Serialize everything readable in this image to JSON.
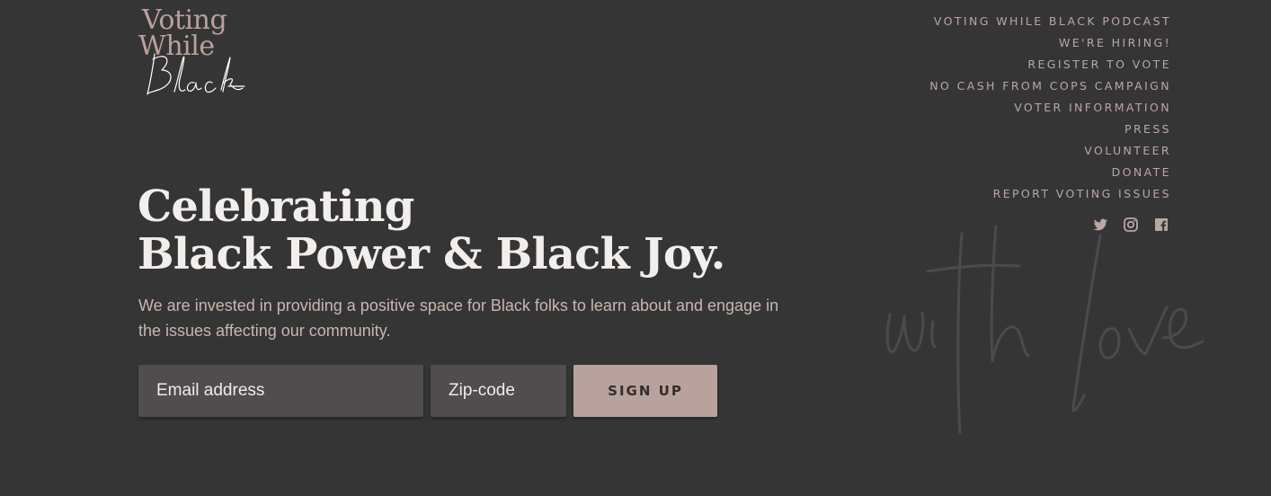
{
  "brand": {
    "logo_line1": "Voting",
    "logo_line2": "While",
    "logo_script": "Black",
    "accent_color": "#b7a29d",
    "background_color": "#363535"
  },
  "nav": [
    "VOTING WHILE BLACK PODCAST",
    "WE'RE HIRING!",
    "REGISTER TO VOTE",
    "NO CASH FROM COPS CAMPAIGN",
    "VOTER INFORMATION",
    "PRESS",
    "VOLUNTEER",
    "DONATE",
    "REPORT VOTING ISSUES"
  ],
  "social": [
    "twitter-icon",
    "instagram-icon",
    "facebook-icon"
  ],
  "hero": {
    "title_line1": "Celebrating",
    "title_line2": "Black Power & Black Joy.",
    "text": "We are invested in providing a positive space for Black folks to learn about and engage in the issues affecting our community."
  },
  "form": {
    "email_placeholder": "Email address",
    "zip_placeholder": "Zip-code",
    "submit_label": "SIGN UP"
  },
  "watermark": "with love"
}
